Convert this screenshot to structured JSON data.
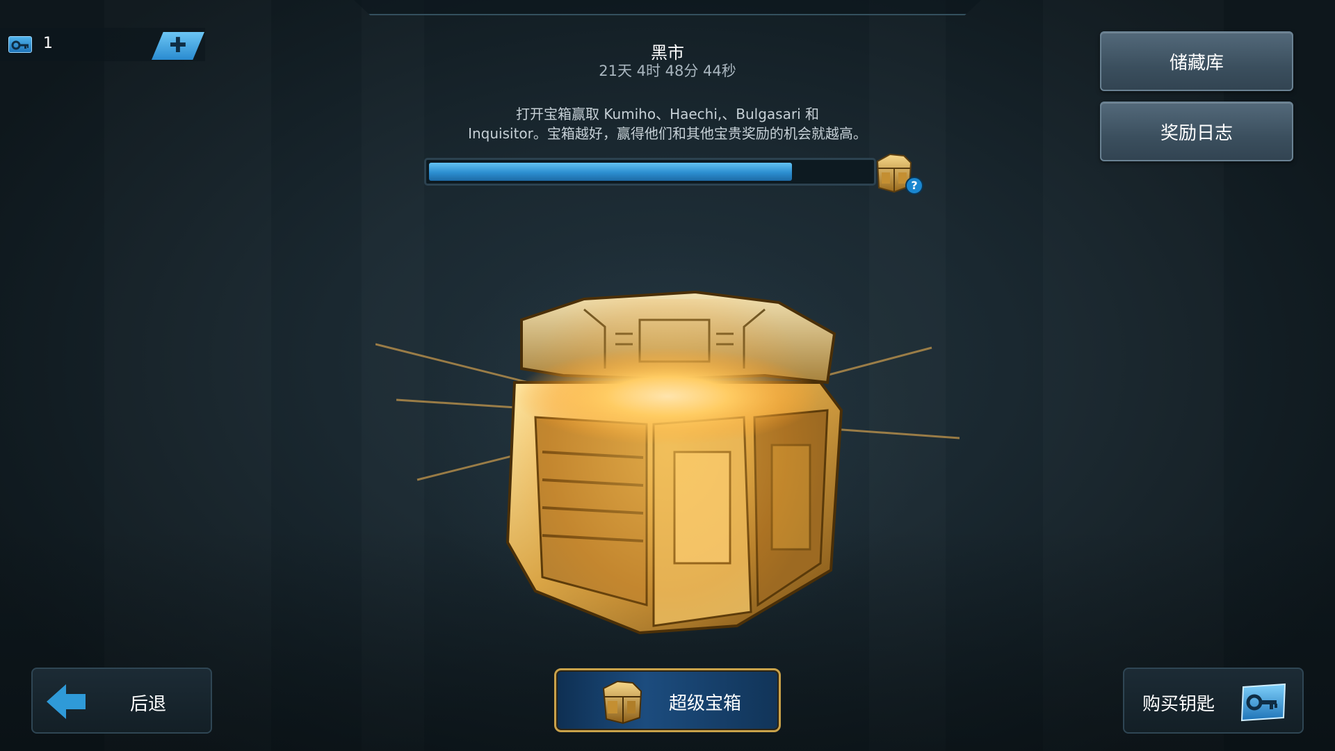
{
  "currency": {
    "key_count": "1",
    "icons": {
      "key": "key-icon",
      "add": "plus-icon"
    }
  },
  "header": {
    "title": "黑市",
    "countdown": "21天 4时 48分 44秒",
    "description_line1": "打开宝箱赢取 Kumiho、Haechi,、Bulgasari 和",
    "description_line2": "Inquisitor。宝箱越好，赢得他们和其他宝贵奖励的机会就越高。"
  },
  "progress": {
    "fill_fraction": 0.82,
    "help_label": "?"
  },
  "side_buttons": {
    "storage": "储藏库",
    "reward_log": "奖励日志"
  },
  "bottom": {
    "back_label": "后退",
    "chest_select_label": "超级宝箱",
    "buy_keys_label": "购买钥匙"
  },
  "colors": {
    "accent_blue": "#2c8ed0",
    "gold": "#c9a24a",
    "background": "#1a2830"
  }
}
